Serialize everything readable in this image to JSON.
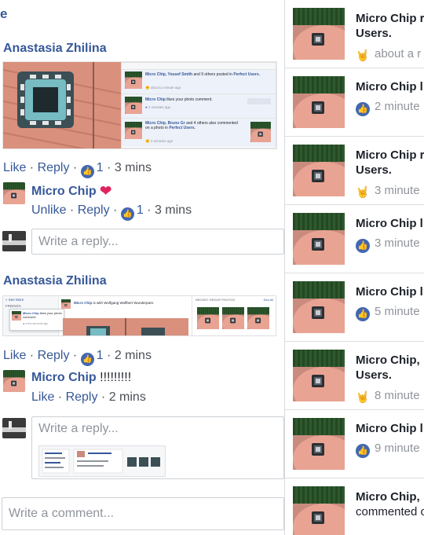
{
  "top_mark": "e",
  "comment1": {
    "author": "Anastasia Zhilina",
    "actions": {
      "like": "Like",
      "reply": "Reply",
      "likes": "1",
      "time": "3 mins"
    },
    "screenshot": {
      "rows": [
        {
          "text_bold": "Micro Chip, Yousef Smith",
          "text": "and 9 others posted in",
          "text_bold2": "Perfect Users.",
          "meta": "about a minute ago"
        },
        {
          "text_bold": "Micro Chip",
          "text": "likes your photo comment.",
          "text_bold2": "",
          "meta": "2 minutes ago"
        },
        {
          "text_bold": "Micro Chip, Bruno Gr",
          "text": "and 4 others also commented on a photo in",
          "text_bold2": "Perfect Users.",
          "meta": "3 minutes ago"
        }
      ]
    }
  },
  "reply1": {
    "name": "Micro Chip",
    "heart": "❤",
    "actions": {
      "unlike": "Unlike",
      "reply": "Reply",
      "likes": "1",
      "time": "3 mins"
    }
  },
  "reply_input1": {
    "placeholder": "Write a reply..."
  },
  "comment2": {
    "author": "Anastasia Zhilina",
    "actions": {
      "like": "Like",
      "reply": "Reply",
      "likes": "1",
      "time": "2 mins"
    },
    "screenshot": {
      "see_more": "« See More",
      "friends": "FRIENDS",
      "post_text_bold": "Micro Chip",
      "post_text": "is with Wolfgang Wolfbert Wunderpant.",
      "popup_text_bold": "Micro Chip",
      "popup_text": "likes your photo comment.",
      "popup_meta": "a few seconds ago",
      "recent": "RECENT GROUP PHOTOS",
      "see_all": "See All"
    }
  },
  "reply2": {
    "name": "Micro Chip",
    "text": "!!!!!!!!!",
    "actions": {
      "like": "Like",
      "reply": "Reply",
      "time": "2 mins"
    }
  },
  "reply_input2": {
    "placeholder": "Write a reply..."
  },
  "comment_input": {
    "placeholder": "Write a comment..."
  },
  "notifications": [
    {
      "line1": "Micro Chip r",
      "line2": "Users.",
      "meta": "about a r",
      "icon": "rock-hand-icon"
    },
    {
      "line1": "Micro Chip l",
      "line2": "",
      "meta": "2 minute",
      "icon": "like-icon"
    },
    {
      "line1": "Micro Chip r",
      "line2": "Users.",
      "meta": "3 minute",
      "icon": "rock-hand-icon"
    },
    {
      "line1": "Micro Chip l",
      "line2": "",
      "meta": "3 minute",
      "icon": "like-icon"
    },
    {
      "line1": "Micro Chip l",
      "line2": "",
      "meta": "5 minute",
      "icon": "like-icon"
    },
    {
      "line1": "Micro Chip,",
      "line2": "Users.",
      "meta": "8 minute",
      "icon": "rock-hand-icon"
    },
    {
      "line1": "Micro Chip l",
      "line2": "",
      "meta": "9 minute",
      "icon": "like-icon"
    },
    {
      "line1": "Micro Chip,",
      "line2": "commented o",
      "meta": "",
      "icon": ""
    }
  ],
  "colors": {
    "link": "#365899",
    "like_blue": "#4267b2",
    "heart": "#e0245e"
  }
}
